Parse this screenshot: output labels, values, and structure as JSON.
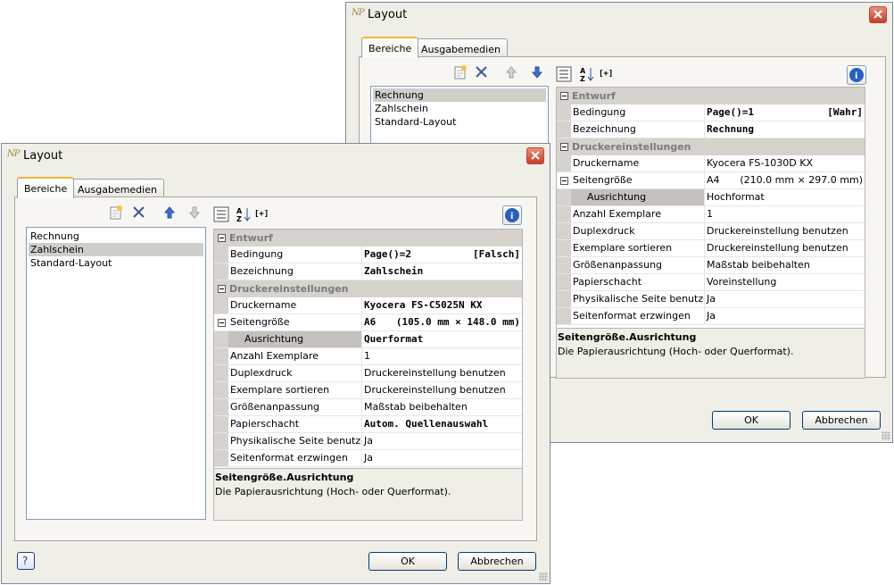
{
  "back_dialog": {
    "title": "Layout",
    "app_icon": "NP",
    "tabs": [
      {
        "label": "Bereiche"
      },
      {
        "label": "Ausgabemedien"
      }
    ],
    "list": [
      {
        "label": "Rechnung"
      },
      {
        "label": "Zahlschein"
      },
      {
        "label": "Standard-Layout"
      }
    ],
    "selected_index": 0,
    "sort_label": "[+]",
    "categories": {
      "entwurf": "Entwurf",
      "drucker": "Druckereinstellungen"
    },
    "props": {
      "bedingung": {
        "name": "Bedingung",
        "value": "Page()=1",
        "flag": "[Wahr]"
      },
      "bezeichnung": {
        "name": "Bezeichnung",
        "value": "Rechnung"
      },
      "druckername": {
        "name": "Druckername",
        "value": "Kyocera FS-1030D KX"
      },
      "seitengroesse": {
        "name": "Seitengröße",
        "value": "A4",
        "size": "(210.0 mm × 297.0 mm)"
      },
      "ausrichtung": {
        "name": "Ausrichtung",
        "value": "Hochformat"
      },
      "exemplare": {
        "name": "Anzahl Exemplare",
        "value": "1"
      },
      "duplex": {
        "name": "Duplexdruck",
        "value": "Druckereinstellung benutzen"
      },
      "sortieren": {
        "name": "Exemplare sortieren",
        "value": "Druckereinstellung benutzen"
      },
      "groesse": {
        "name": "Größenanpassung",
        "value": "Maßstab beibehalten"
      },
      "schacht": {
        "name": "Papierschacht",
        "value": "Voreinstellung"
      },
      "physisch": {
        "name": "Physikalische Seite benutzen",
        "value": "Ja"
      },
      "erzwingen": {
        "name": "Seitenformat erzwingen",
        "value": "Ja"
      }
    },
    "description": {
      "title": "Seitengröße.Ausrichtung",
      "text": "Die Papierausrichtung (Hoch- oder Querformat)."
    },
    "ok_label": "OK",
    "cancel_label": "Abbrechen"
  },
  "front_dialog": {
    "title": "Layout",
    "app_icon": "NP",
    "tabs": [
      {
        "label": "Bereiche"
      },
      {
        "label": "Ausgabemedien"
      }
    ],
    "list": [
      {
        "label": "Rechnung"
      },
      {
        "label": "Zahlschein"
      },
      {
        "label": "Standard-Layout"
      }
    ],
    "selected_index": 1,
    "sort_label": "[+]",
    "categories": {
      "entwurf": "Entwurf",
      "drucker": "Druckereinstellungen"
    },
    "props": {
      "bedingung": {
        "name": "Bedingung",
        "value": "Page()=2",
        "flag": "[Falsch]"
      },
      "bezeichnung": {
        "name": "Bezeichnung",
        "value": "Zahlschein"
      },
      "druckername": {
        "name": "Druckername",
        "value": "Kyocera FS-C5025N KX"
      },
      "seitengroesse": {
        "name": "Seitengröße",
        "value": "A6",
        "size": "(105.0 mm × 148.0 mm)"
      },
      "ausrichtung": {
        "name": "Ausrichtung",
        "value": "Querformat"
      },
      "exemplare": {
        "name": "Anzahl Exemplare",
        "value": "1"
      },
      "duplex": {
        "name": "Duplexdruck",
        "value": "Druckereinstellung benutzen"
      },
      "sortieren": {
        "name": "Exemplare sortieren",
        "value": "Druckereinstellung benutzen"
      },
      "groesse": {
        "name": "Größenanpassung",
        "value": "Maßstab beibehalten"
      },
      "schacht": {
        "name": "Papierschacht",
        "value": "Autom. Quellenauswahl"
      },
      "physisch": {
        "name": "Physikalische Seite benutzen",
        "value": "Ja"
      },
      "erzwingen": {
        "name": "Seitenformat erzwingen",
        "value": "Ja"
      }
    },
    "description": {
      "title": "Seitengröße.Ausrichtung",
      "text": "Die Papierausrichtung (Hoch- oder Querformat)."
    },
    "ok_label": "OK",
    "cancel_label": "Abbrechen",
    "help_label": "?"
  },
  "colors": {
    "accent_tab": "#f3b23c",
    "close_red": "#c6402a",
    "selection": "#cfcfca",
    "category_bg": "#d6d3ce"
  }
}
